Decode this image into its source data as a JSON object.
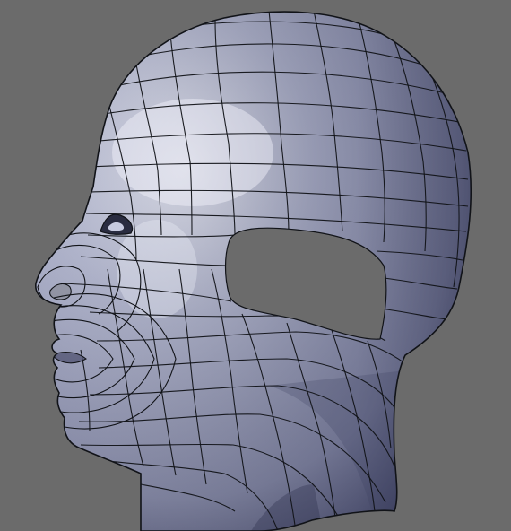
{
  "viewport": {
    "background_color": "#6b6b6b",
    "object": {
      "name": "head-mesh",
      "shading_color": "#a9adc6",
      "highlight_color": "#e9ebf8",
      "shadow_color": "#3d405f",
      "wire_color": "#111318",
      "cavity_color": "#6b6b6b"
    }
  }
}
